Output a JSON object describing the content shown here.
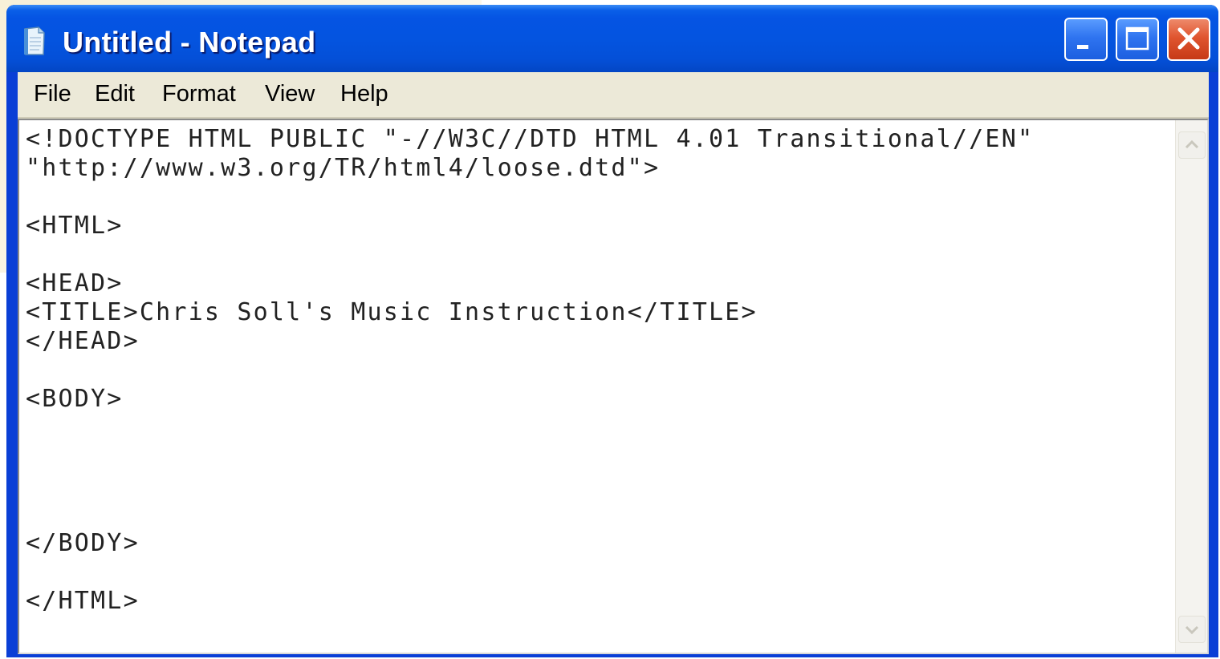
{
  "window": {
    "title": "Untitled - Notepad",
    "app_icon": "notepad-icon",
    "titlebar_color": "#0454e0",
    "close_color": "#e0552f"
  },
  "caption_buttons": {
    "minimize_icon": "minimize-icon",
    "maximize_icon": "maximize-icon",
    "close_icon": "close-icon"
  },
  "menu": {
    "items": [
      {
        "label": "File"
      },
      {
        "label": "Edit"
      },
      {
        "label": "Format"
      },
      {
        "label": "View"
      },
      {
        "label": "Help"
      }
    ]
  },
  "editor": {
    "content": "<!DOCTYPE HTML PUBLIC \"-//W3C//DTD HTML 4.01 Transitional//EN\"\n\"http://www.w3.org/TR/html4/loose.dtd\">\n\n<HTML>\n\n<HEAD>\n<TITLE>Chris Soll's Music Instruction</TITLE>\n</HEAD>\n\n<BODY>\n\n\n\n\n</BODY>\n\n</HTML>"
  },
  "scrollbar": {
    "up_icon": "scroll-up-arrow-icon",
    "down_icon": "scroll-down-arrow-icon"
  }
}
